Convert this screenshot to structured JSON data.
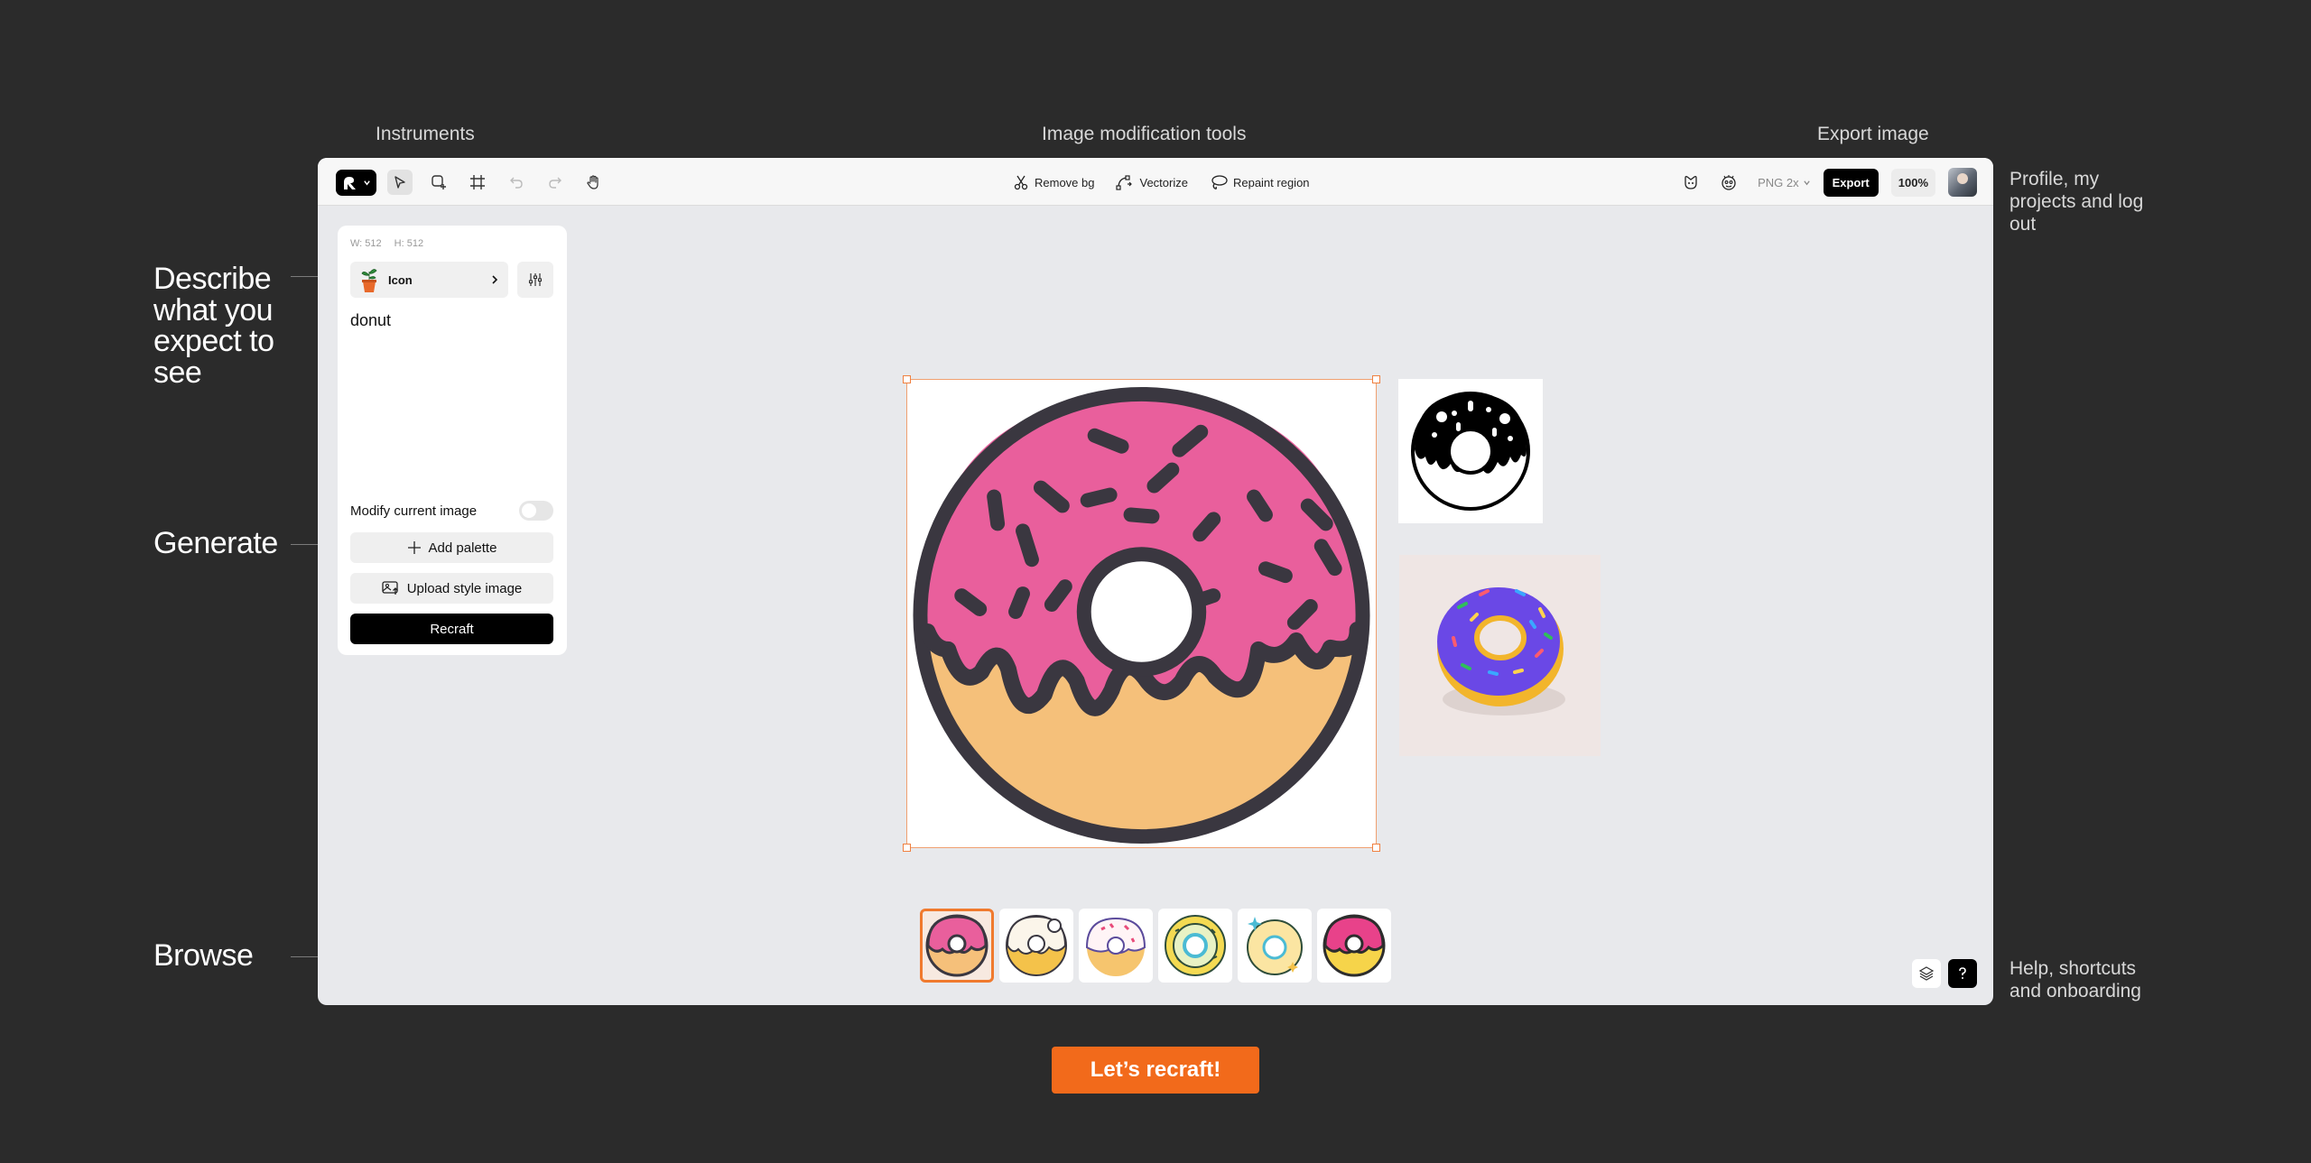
{
  "annotations": {
    "instruments": "Instruments",
    "image_modification_tools": "Image modification tools",
    "export_image": "Export image",
    "profile": "Profile, my projects and log out",
    "describe": "Describe what you expect to see",
    "generate": "Generate",
    "browse": "Browse",
    "help": "Help, shortcuts and onboarding"
  },
  "toolbar": {
    "logo_icon": "recraft-logo-icon",
    "tools": [
      "select-arrow-icon",
      "add-frame-icon",
      "frame-icon",
      "undo-icon",
      "redo-icon",
      "hand-icon"
    ],
    "mid_tools": [
      {
        "label": "Remove bg",
        "icon": "remove-bg-icon"
      },
      {
        "label": "Vectorize",
        "icon": "vectorize-icon"
      },
      {
        "label": "Repaint region",
        "icon": "lasso-icon"
      }
    ],
    "format": "PNG 2x",
    "export_label": "Export",
    "zoom": "100%"
  },
  "panel": {
    "width_label": "W: 512",
    "height_label": "H: 512",
    "style_label": "Icon",
    "prompt": "donut",
    "modify_label": "Modify current image",
    "modify_on": false,
    "add_palette": "Add palette",
    "upload_style": "Upload style image",
    "recraft": "Recraft"
  },
  "colors": {
    "accent": "#f26a1b",
    "frosting_pink": "#e95f9c",
    "dough": "#f5c07a",
    "outline": "#3a3740"
  },
  "cta": "Let’s recraft!"
}
